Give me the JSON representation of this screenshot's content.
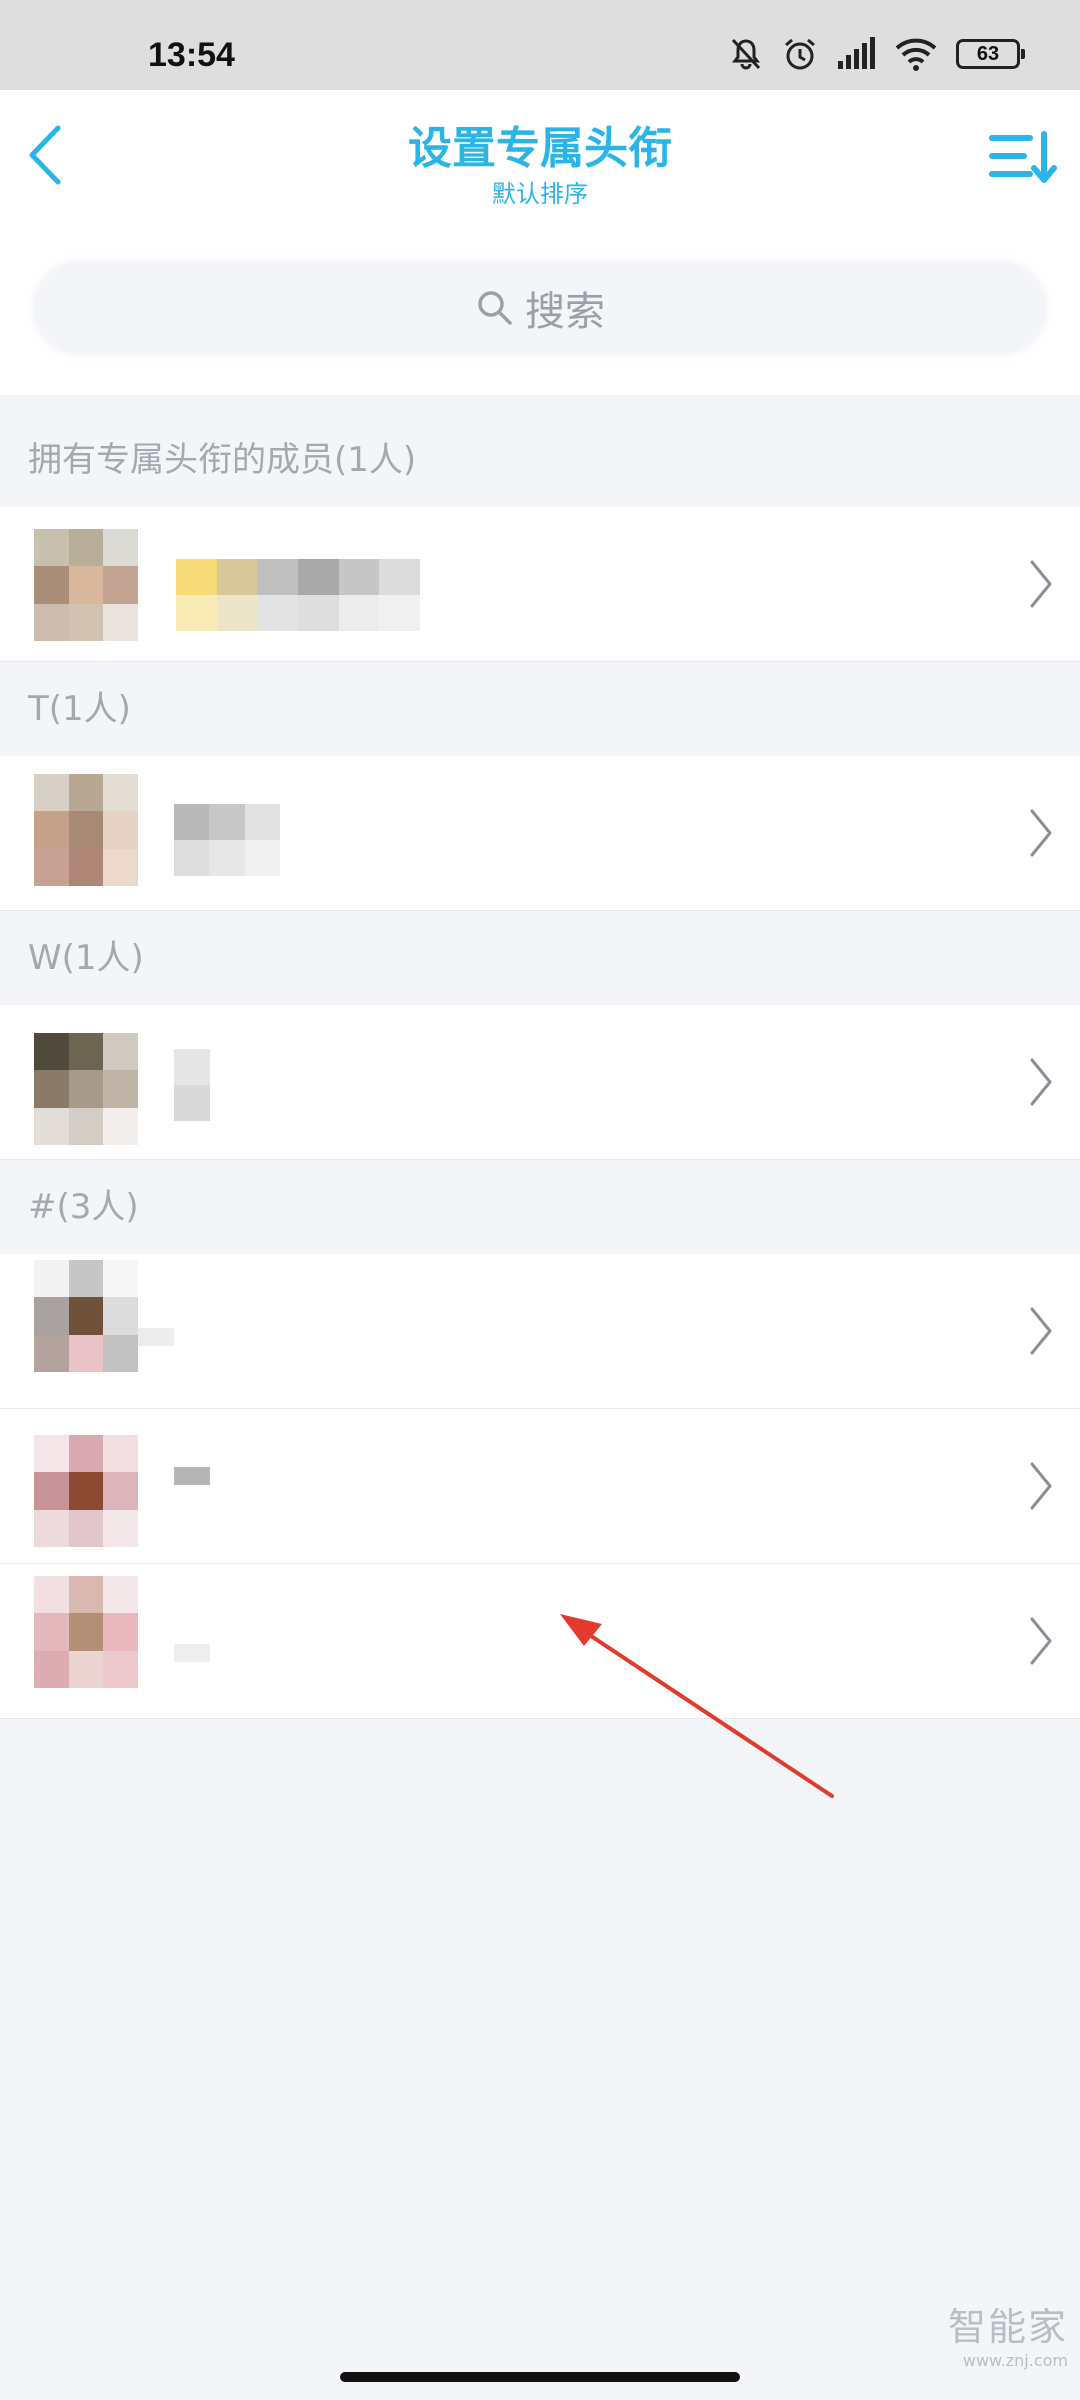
{
  "status_bar": {
    "time": "13:54",
    "icons": [
      "mute-bell-icon",
      "alarm-icon",
      "signal-icon",
      "wifi-icon"
    ],
    "battery": "63"
  },
  "header": {
    "title": "设置专属头衔",
    "subtitle": "默认排序",
    "back_icon": "chevron-left-icon",
    "sort_icon": "sort-list-icon"
  },
  "search": {
    "placeholder": "搜索",
    "icon": "search-icon"
  },
  "sections": [
    {
      "title": "拥有专属头衔的成员(1人)",
      "rows": 1
    },
    {
      "title": "T(1人)",
      "rows": 1
    },
    {
      "title": "W(1人)",
      "rows": 1
    },
    {
      "title": "#(3人)",
      "rows": 3
    }
  ],
  "colors": {
    "accent": "#2bb5e6",
    "section_text": "#a4a9b0",
    "background": "#f3f5f9",
    "annotation_arrow": "#e23b2e"
  },
  "watermark": {
    "brand": "智能家",
    "url": "www.znj.com"
  }
}
